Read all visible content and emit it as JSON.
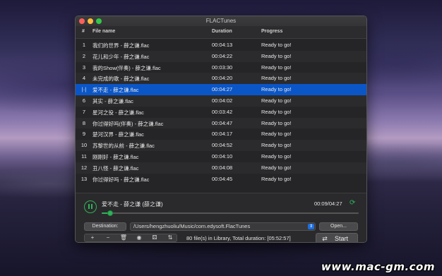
{
  "window": {
    "title": "FLACTunes"
  },
  "table": {
    "columns": {
      "num": "#",
      "name": "File name",
      "duration": "Duration",
      "progress": "Progress"
    },
    "selected_marker": "|·|",
    "rows": [
      {
        "num": "1",
        "name": "我们的世界 - 薛之谦.flac",
        "duration": "00:04:13",
        "progress": "Ready to go!"
      },
      {
        "num": "2",
        "name": "花儿和少年 - 薛之谦.flac",
        "duration": "00:04:22",
        "progress": "Ready to go!"
      },
      {
        "num": "3",
        "name": "我的Show(伴奏) - 薛之谦.flac",
        "duration": "00:03:30",
        "progress": "Ready to go!"
      },
      {
        "num": "4",
        "name": "未完成的歌 - 薛之谦.flac",
        "duration": "00:04:20",
        "progress": "Ready to go!"
      },
      {
        "num": "5",
        "name": "爱不走 - 薛之谦.flac",
        "duration": "00:04:27",
        "progress": "Ready to go!",
        "selected": true
      },
      {
        "num": "6",
        "name": "其实 - 薛之谦.flac",
        "duration": "00:04:02",
        "progress": "Ready to go!"
      },
      {
        "num": "7",
        "name": "星河之役 - 薛之谦.flac",
        "duration": "00:03:42",
        "progress": "Ready to go!"
      },
      {
        "num": "8",
        "name": "你过得好吗(伴奏) - 薛之谦.flac",
        "duration": "00:04:47",
        "progress": "Ready to go!"
      },
      {
        "num": "9",
        "name": "楚河汉界 - 薛之谦.flac",
        "duration": "00:04:17",
        "progress": "Ready to go!"
      },
      {
        "num": "10",
        "name": "苏黎世的从前 - 薛之谦.flac",
        "duration": "00:04:52",
        "progress": "Ready to go!"
      },
      {
        "num": "11",
        "name": "刚刚好 - 薛之谦.flac",
        "duration": "00:04:10",
        "progress": "Ready to go!"
      },
      {
        "num": "12",
        "name": "丑八怪 - 薛之谦.flac",
        "duration": "00:04:08",
        "progress": "Ready to go!"
      },
      {
        "num": "13",
        "name": "你过得好吗 - 薛之谦.flac",
        "duration": "00:04:45",
        "progress": "Ready to go!"
      }
    ]
  },
  "player": {
    "now_playing": "爱不走 - 薛之谦 (薛之谦)",
    "time": "00:09/04:27",
    "progress_fraction": 0.034,
    "pause_icon": "pause-icon",
    "repeat_icon": "repeat-icon"
  },
  "destination": {
    "button_label": "Destination:",
    "path": "/Users/hengzhuoliu/Music/com.edysoft.FlacTunes",
    "open_label": "Open..."
  },
  "toolbar": {
    "tools": [
      "add-icon",
      "remove-icon",
      "trash-icon",
      "info-icon",
      "shuffle-icon",
      "sort-icon"
    ]
  },
  "status": {
    "library_info": "80 file(s) in Library, Total duration: [05:52:57]"
  },
  "start": {
    "label": "Start",
    "icon": "convert-icon"
  },
  "watermark": {
    "text": "www.mac-gm.com"
  },
  "colors": {
    "accent": "#31b25a",
    "selection": "#0b56c7",
    "window_bg": "#252527"
  }
}
